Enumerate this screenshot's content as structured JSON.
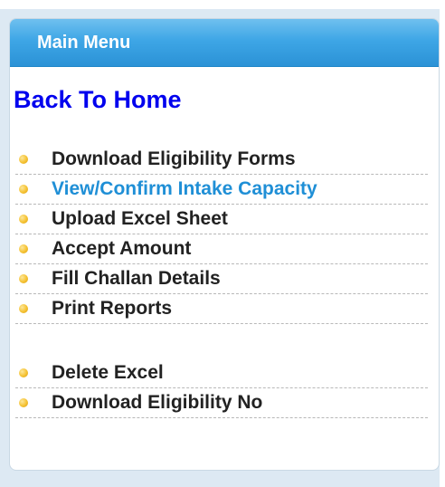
{
  "menu": {
    "header_title": "Main Menu",
    "back_home_label": "Back To Home",
    "group1": [
      {
        "label": "Download Eligibility Forms",
        "active": false
      },
      {
        "label": "View/Confirm Intake Capacity",
        "active": true
      },
      {
        "label": "Upload Excel Sheet",
        "active": false
      },
      {
        "label": "Accept Amount",
        "active": false
      },
      {
        "label": "Fill Challan Details",
        "active": false
      },
      {
        "label": "Print Reports",
        "active": false
      }
    ],
    "group2": [
      {
        "label": "Delete Excel",
        "active": false
      },
      {
        "label": "Download Eligibility No",
        "active": false
      }
    ]
  },
  "colors": {
    "header_gradient_top": "#6fc0ef",
    "header_gradient_bottom": "#2b92d6",
    "back_home_link": "#0000ee",
    "active_link": "#1f8fd6",
    "default_link": "#222222",
    "bullet": "#f5c232",
    "frame_background": "#dde9f3"
  },
  "icons": {
    "bullet": "bullet-icon"
  }
}
